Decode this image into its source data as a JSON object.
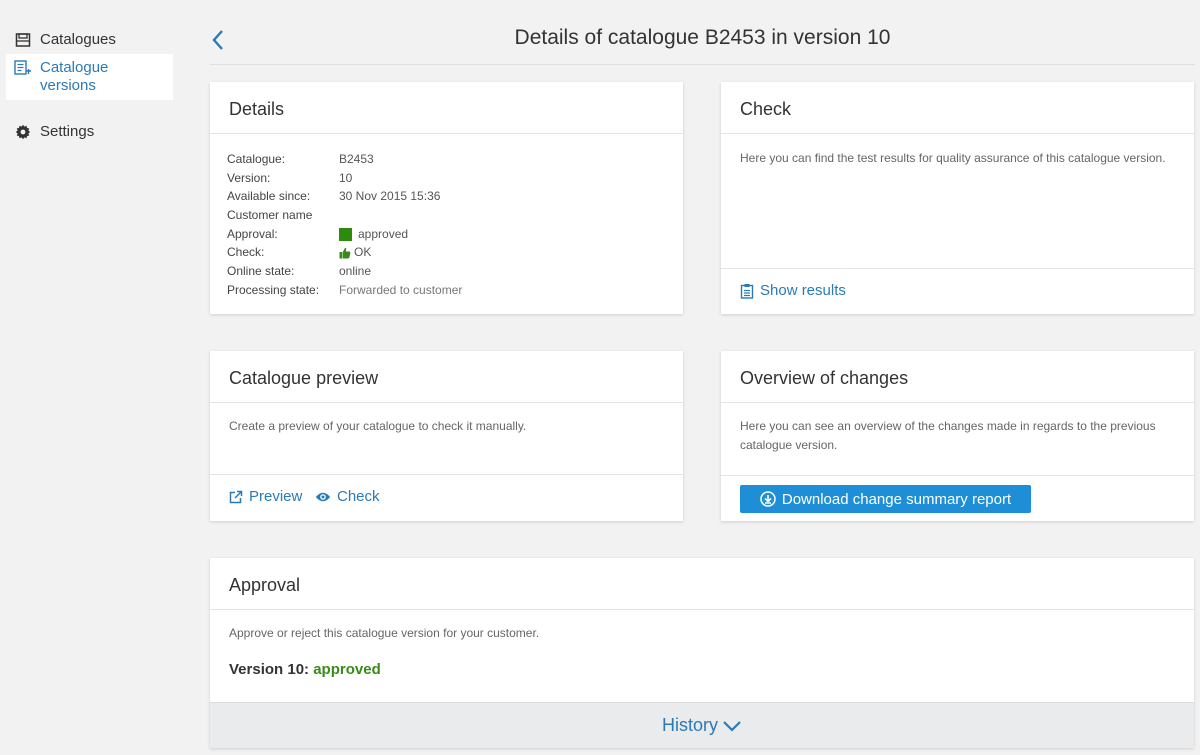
{
  "sidebar": {
    "items": [
      {
        "label": "Catalogues",
        "icon": "catalogue-icon"
      },
      {
        "label": "Catalogue",
        "label2": "versions",
        "icon": "catalogue-versions-icon",
        "active": true
      },
      {
        "label": "Settings",
        "icon": "gear-icon"
      }
    ]
  },
  "header": {
    "title": "Details of catalogue B2453 in version 10",
    "back_icon": "chevron-left-icon"
  },
  "details": {
    "title": "Details",
    "rows": [
      {
        "key": "Catalogue:",
        "value": "B2453"
      },
      {
        "key": "Version:",
        "value": "10"
      },
      {
        "key": "Available since:",
        "value": "30 Nov 2015 15:36"
      },
      {
        "key": "Customer name",
        "value": ""
      },
      {
        "key": "Approval:",
        "value": "approved"
      },
      {
        "key": "Check:",
        "value": "OK"
      },
      {
        "key": "Online state:",
        "value": "online"
      },
      {
        "key": "Processing state:",
        "value": "Forwarded to customer"
      }
    ]
  },
  "check": {
    "title": "Check",
    "text": "Here you can find the test results for quality assurance of this catalogue version.",
    "show_results": "Show results"
  },
  "preview": {
    "title": "Catalogue preview",
    "text": "Create a preview of your catalogue to check it manually.",
    "preview_link": "Preview",
    "check_link": "Check"
  },
  "changes": {
    "title": "Overview of changes",
    "text": "Here you can see an overview of the changes made in regards to the previous catalogue version.",
    "download_label": "Download change summary report"
  },
  "approval": {
    "title": "Approval",
    "text": "Approve or reject this catalogue version for your customer.",
    "version_label": "Version 10:",
    "status": "approved",
    "history": "History"
  },
  "colors": {
    "accent": "#2a7ab8",
    "button": "#1e8fd6",
    "approved_green": "#2d8a0a",
    "background": "#f2f2f2"
  }
}
